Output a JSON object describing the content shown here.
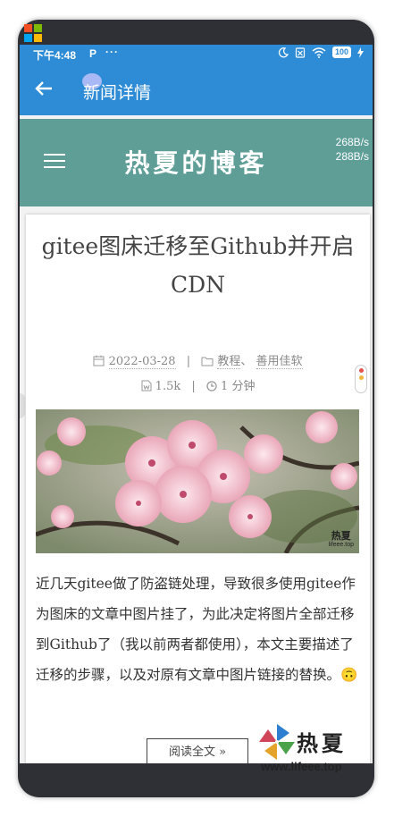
{
  "status": {
    "time": "下午4:48",
    "p_icon": "P",
    "dots": "···",
    "battery": "100"
  },
  "appbar": {
    "title": "新闻详情"
  },
  "blog": {
    "brand": "热夏的博客",
    "speed_up": "268B/s",
    "speed_down": "288B/s"
  },
  "post": {
    "title_line1": "gitee图床迁移至Github并开启",
    "title_line2": "CDN",
    "date": "2022-03-28",
    "category1": "教程",
    "category_sep": "、",
    "category2": "善用佳软",
    "words": "1.5k",
    "read_time": "1 分钟",
    "hero_watermark_line1": "热夏",
    "hero_watermark_line2": "lifeee.top",
    "body": "近几天gitee做了防盗链处理，导致很多使用gitee作为图床的文章中图片挂了，为此决定将图片全部迁移到Github了（我以前两者都使用），本文主要描述了迁移的步骤，以及对原有文章中图片链接的替换。🙃",
    "read_more": "阅读全文 »"
  },
  "footer_logo": {
    "name": "热夏",
    "url": "www.lifeee.top"
  },
  "colors": {
    "appbar": "#2e8bd6",
    "header": "#5e9e97",
    "frame": "#2e3035"
  }
}
